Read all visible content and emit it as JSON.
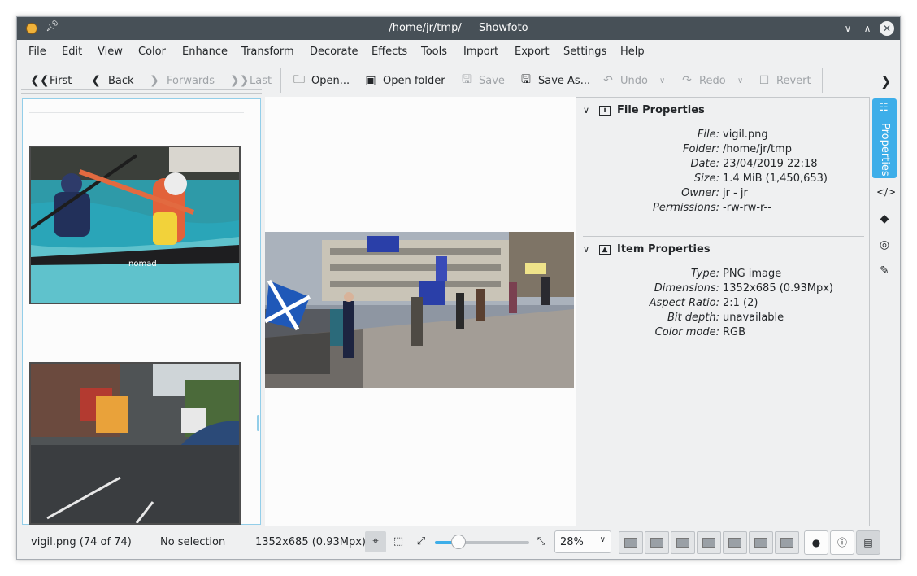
{
  "window": {
    "title": "/home/jr/tmp/ — Showfoto"
  },
  "menu": [
    "File",
    "Edit",
    "View",
    "Color",
    "Enhance",
    "Transform",
    "Decorate",
    "Effects",
    "Tools",
    "Import",
    "Export",
    "Settings",
    "Help"
  ],
  "toolbar": {
    "first": "First",
    "back": "Back",
    "forwards": "Forwards",
    "last": "Last",
    "open": "Open...",
    "open_folder": "Open folder",
    "save": "Save",
    "save_as": "Save As...",
    "undo": "Undo",
    "redo": "Redo",
    "revert": "Revert"
  },
  "file_properties": {
    "title": "File Properties",
    "rows": [
      {
        "k": "File:",
        "v": "vigil.png"
      },
      {
        "k": "Folder:",
        "v": "/home/jr/tmp"
      },
      {
        "k": "Date:",
        "v": "23/04/2019 22:18"
      },
      {
        "k": "Size:",
        "v": "1.4 MiB (1,450,653)"
      },
      {
        "k": "Owner:",
        "v": "jr - jr"
      },
      {
        "k": "Permissions:",
        "v": "-rw-rw-r--"
      }
    ]
  },
  "item_properties": {
    "title": "Item Properties",
    "rows": [
      {
        "k": "Type:",
        "v": "PNG image"
      },
      {
        "k": "Dimensions:",
        "v": "1352x685 (0.93Mpx)"
      },
      {
        "k": "Aspect Ratio:",
        "v": "2:1 (2)"
      },
      {
        "k": "Bit depth:",
        "v": "unavailable"
      },
      {
        "k": "Color mode:",
        "v": "RGB"
      }
    ]
  },
  "sidebar": {
    "properties_tab": "Properties"
  },
  "status": {
    "file": "vigil.png (74 of 74)",
    "selection": "No selection",
    "dimensions": "1352x685 (0.93Mpx)",
    "zoom": "28%",
    "zoom_fraction": 0.25
  }
}
